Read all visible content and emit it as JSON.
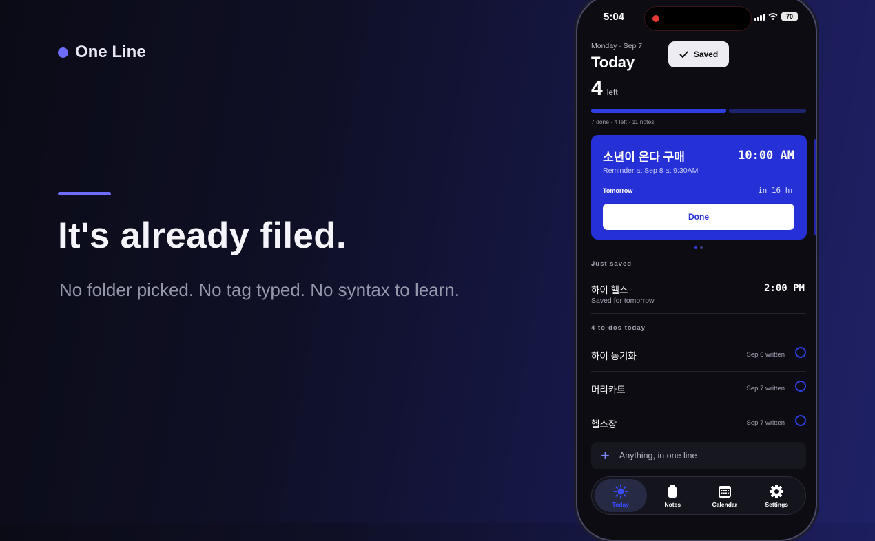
{
  "brand": {
    "name": "One Line"
  },
  "hero": {
    "headline": "It's already filed.",
    "subline": "No folder picked. No tag typed. No syntax to learn."
  },
  "phone": {
    "status": {
      "time": "5:04",
      "battery": "70"
    },
    "header": {
      "date": "Monday · Sep 7",
      "title": "Today",
      "count": "4",
      "count_label": "left"
    },
    "toast": {
      "label": "Saved"
    },
    "progress": {
      "done": 7,
      "total": 11,
      "caption": "7 done · 4 left · 11 notes"
    },
    "card": {
      "title": "소년이 온다 구매",
      "time": "10:00 AM",
      "reminder": "Reminder at Sep 8 at 9:30AM",
      "when": "Tomorrow",
      "in": "in 16 hr",
      "done_label": "Done"
    },
    "just_saved": {
      "label": "Just saved",
      "name": "하이 헬스",
      "sub": "Saved for tomorrow",
      "time": "2:00 PM"
    },
    "todos": {
      "label": "4 to-dos today",
      "items": [
        {
          "name": "하이 동기화",
          "meta": "Sep 6 written"
        },
        {
          "name": "머리카트",
          "meta": "Sep 7 written"
        },
        {
          "name": "헬스장",
          "meta": "Sep 7 written"
        }
      ]
    },
    "composer": {
      "placeholder": "Anything, in one line"
    },
    "tabs": [
      {
        "label": "Today",
        "icon": "sun-icon",
        "active": true
      },
      {
        "label": "Notes",
        "icon": "notes-icon",
        "active": false
      },
      {
        "label": "Calendar",
        "icon": "calendar-icon",
        "active": false
      },
      {
        "label": "Settings",
        "icon": "gear-icon",
        "active": false
      }
    ]
  },
  "colors": {
    "accent": "#6c6cff",
    "card": "#2530d6",
    "background": "#0f1026"
  }
}
